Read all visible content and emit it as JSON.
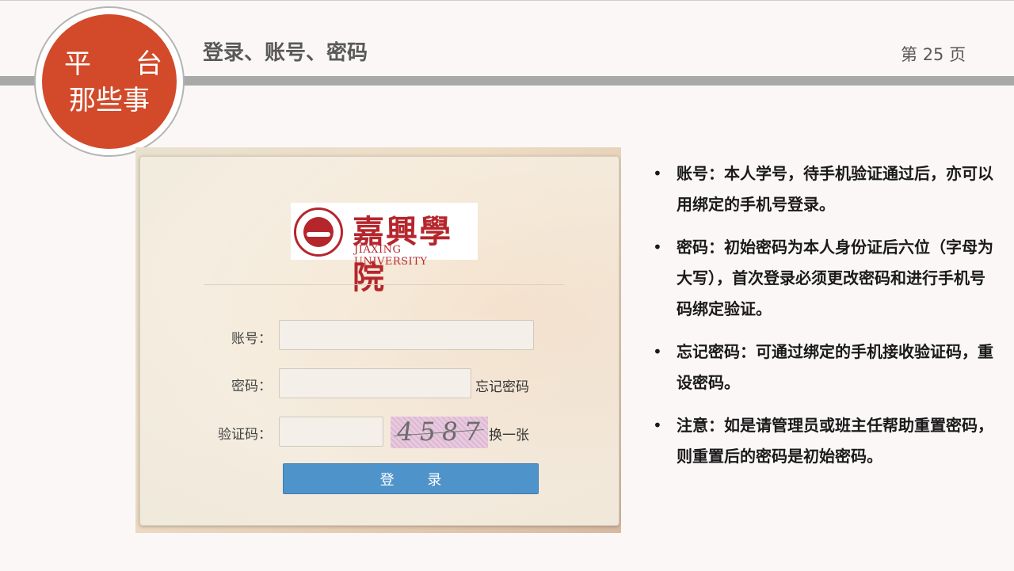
{
  "header": {
    "badge_line1_a": "平",
    "badge_line1_b": "台",
    "badge_line2": "那些事",
    "title": "登录、账号、密码",
    "page_prefix": "第",
    "page_number": "25",
    "page_suffix": "页"
  },
  "login": {
    "logo_cn": "嘉興學院",
    "logo_en": "JIAXING UNIVERSITY",
    "account_label": "账号：",
    "password_label": "密码：",
    "forgot_password": "忘记密码",
    "captcha_label": "验证码：",
    "captcha_text": "4587",
    "refresh_captcha": "换一张",
    "login_button": "登 录",
    "account_value": "",
    "password_value": "",
    "captcha_value": ""
  },
  "notes": {
    "bullet": "•",
    "items": [
      "账号：本人学号，待手机验证通过后，亦可以用绑定的手机号登录。",
      "密码：初始密码为本人身份证后六位（字母为大写），首次登录必须更改密码和进行手机号码绑定验证。",
      "忘记密码：可通过绑定的手机接收验证码，重设密码。",
      "注意：如是请管理员或班主任帮助重置密码，则重置后的密码是初始密码。"
    ]
  },
  "colors": {
    "badge": "#d24a2a",
    "header_bar": "#a9a9a9",
    "login_button": "#4f93cb",
    "logo_red": "#b5262c"
  }
}
